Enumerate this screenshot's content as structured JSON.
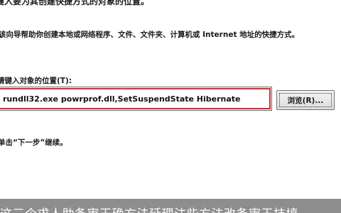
{
  "dialog": {
    "heading": "键入要为其创建快捷方式的对象的位置。",
    "description": "该向导帮助你创建本地或网络程序、文件、文件夹、计算机或 Internet 地址的快捷方式。",
    "field_label": "请键入对象的位置(T):",
    "location_value": "rundll32.exe powrprof.dll,SetSuspendState Hibernate",
    "browse_label": "浏览(R)...",
    "instruction": "单击“下一步”继续。"
  },
  "caption": {
    "text": "这三个求人助条审王确方法延理注些方法改条审王技填"
  }
}
